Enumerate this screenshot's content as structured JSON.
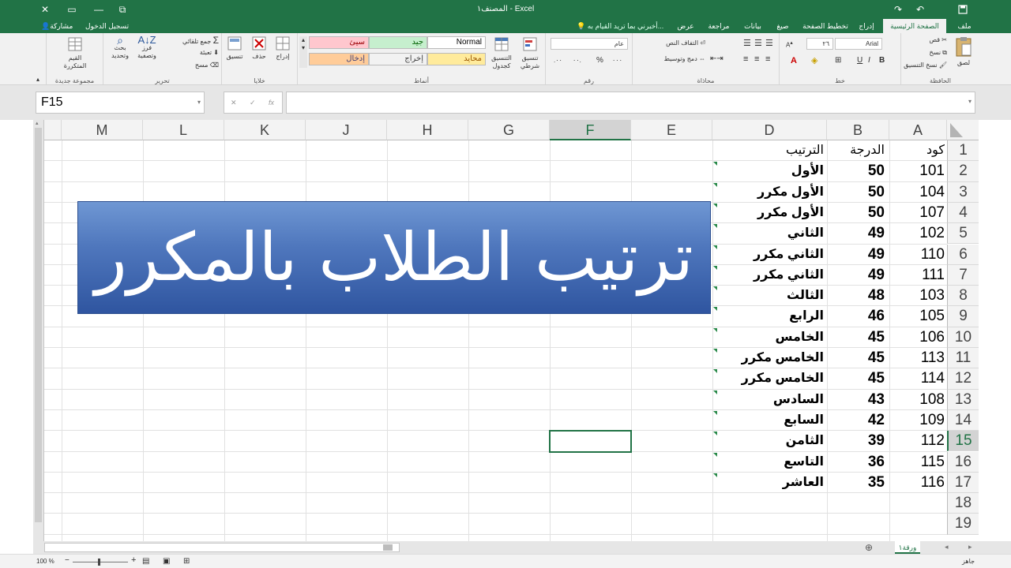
{
  "titlebar": {
    "title": "المصنف١ - Excel",
    "controls": [
      "✕",
      "▭",
      "—",
      "⧉"
    ],
    "save_icon": "save-icon",
    "undo_icon": "undo-icon",
    "redo_icon": "redo-icon"
  },
  "tabs": {
    "items": [
      "ملف",
      "الصفحة الرئيسية",
      "إدراج",
      "تخطيط الصفحة",
      "صيغ",
      "بيانات",
      "مراجعة",
      "عرض"
    ],
    "active_index": 1,
    "tell_me": "أخبرني بما تريد القيام به...",
    "share": "مشاركة",
    "signin": "تسجيل الدخول"
  },
  "ribbon": {
    "clipboard": {
      "label": "الحافظة",
      "paste": "لصق",
      "cut": "قص",
      "copy": "نسخ",
      "format_painter": "نسخ التنسيق"
    },
    "font": {
      "label": "خط",
      "name": "Arial",
      "size": "٢٦",
      "bold": "B",
      "italic": "I",
      "underline": "U"
    },
    "alignment": {
      "label": "محاذاة",
      "wrap": "التفاف النص",
      "merge": "دمج وتوسيط"
    },
    "number": {
      "label": "رقم",
      "format": "عام",
      "percent": "%",
      "comma": "٠٠٠",
      "inc": "٠٠.",
      "dec": ".٠٠"
    },
    "styles": {
      "label": "أنماط",
      "conditional": "تنسيق شرطي",
      "as_table": "التنسيق كجدول",
      "cells": [
        {
          "text": "Normal",
          "bg": "#ffffff",
          "fg": "#000000"
        },
        {
          "text": "جيد",
          "bg": "#c6efce",
          "fg": "#006100"
        },
        {
          "text": "سيئ",
          "bg": "#ffc7ce",
          "fg": "#9c0006"
        },
        {
          "text": "محايد",
          "bg": "#ffeb9c",
          "fg": "#9c5700"
        },
        {
          "text": "إخراج",
          "bg": "#f2f2f2",
          "fg": "#3f3f3f"
        },
        {
          "text": "إدخال",
          "bg": "#ffcc99",
          "fg": "#3f3f76"
        }
      ]
    },
    "cells": {
      "label": "خلايا",
      "insert": "إدراج",
      "delete": "حذف",
      "format": "تنسيق"
    },
    "editing": {
      "label": "تحرير",
      "autosum": "جمع تلقائي",
      "fill": "تعبئة",
      "clear": "مسح",
      "sort": "فرز وتصفية",
      "find": "بحث وتحديد"
    },
    "new_group": {
      "label": "مجموعة جديدة",
      "button": "القيم المتكررة"
    }
  },
  "formula_bar": {
    "name_box": "F15",
    "cancel": "✕",
    "enter": "✓",
    "fx": "fx",
    "value": ""
  },
  "grid": {
    "columns": [
      "A",
      "B",
      "D",
      "E",
      "F",
      "G",
      "H",
      "J",
      "K",
      "L",
      "M"
    ],
    "selected_column": "F",
    "rows": [
      "1",
      "2",
      "3",
      "4",
      "5",
      "6",
      "7",
      "8",
      "9",
      "10",
      "11",
      "12",
      "13",
      "14",
      "15",
      "16",
      "17",
      "18",
      "19"
    ],
    "selected_row": "15",
    "header_row": {
      "a": "كود",
      "b": "الدرجة",
      "d": "الترتيب"
    },
    "data": [
      {
        "a": "101",
        "b": "50",
        "d": "الأول"
      },
      {
        "a": "104",
        "b": "50",
        "d": "الأول مكرر"
      },
      {
        "a": "107",
        "b": "50",
        "d": "الأول مكرر"
      },
      {
        "a": "102",
        "b": "49",
        "d": "الثاني"
      },
      {
        "a": "110",
        "b": "49",
        "d": "الثاني مكرر"
      },
      {
        "a": "111",
        "b": "49",
        "d": "الثاني مكرر"
      },
      {
        "a": "103",
        "b": "48",
        "d": "الثالث"
      },
      {
        "a": "105",
        "b": "46",
        "d": "الرابع"
      },
      {
        "a": "106",
        "b": "45",
        "d": "الخامس"
      },
      {
        "a": "113",
        "b": "45",
        "d": "الخامس مكرر"
      },
      {
        "a": "114",
        "b": "45",
        "d": "الخامس مكرر"
      },
      {
        "a": "108",
        "b": "43",
        "d": "السادس"
      },
      {
        "a": "109",
        "b": "42",
        "d": "السابع"
      },
      {
        "a": "112",
        "b": "39",
        "d": "الثامن"
      },
      {
        "a": "115",
        "b": "36",
        "d": "التاسع"
      },
      {
        "a": "116",
        "b": "35",
        "d": "العاشر"
      }
    ],
    "banner_text": "ترتيب الطلاب بالمكرر"
  },
  "sheets": {
    "tab": "ورقة١",
    "add": "⊕"
  },
  "status": {
    "ready": "جاهز",
    "zoom": "100 %"
  }
}
